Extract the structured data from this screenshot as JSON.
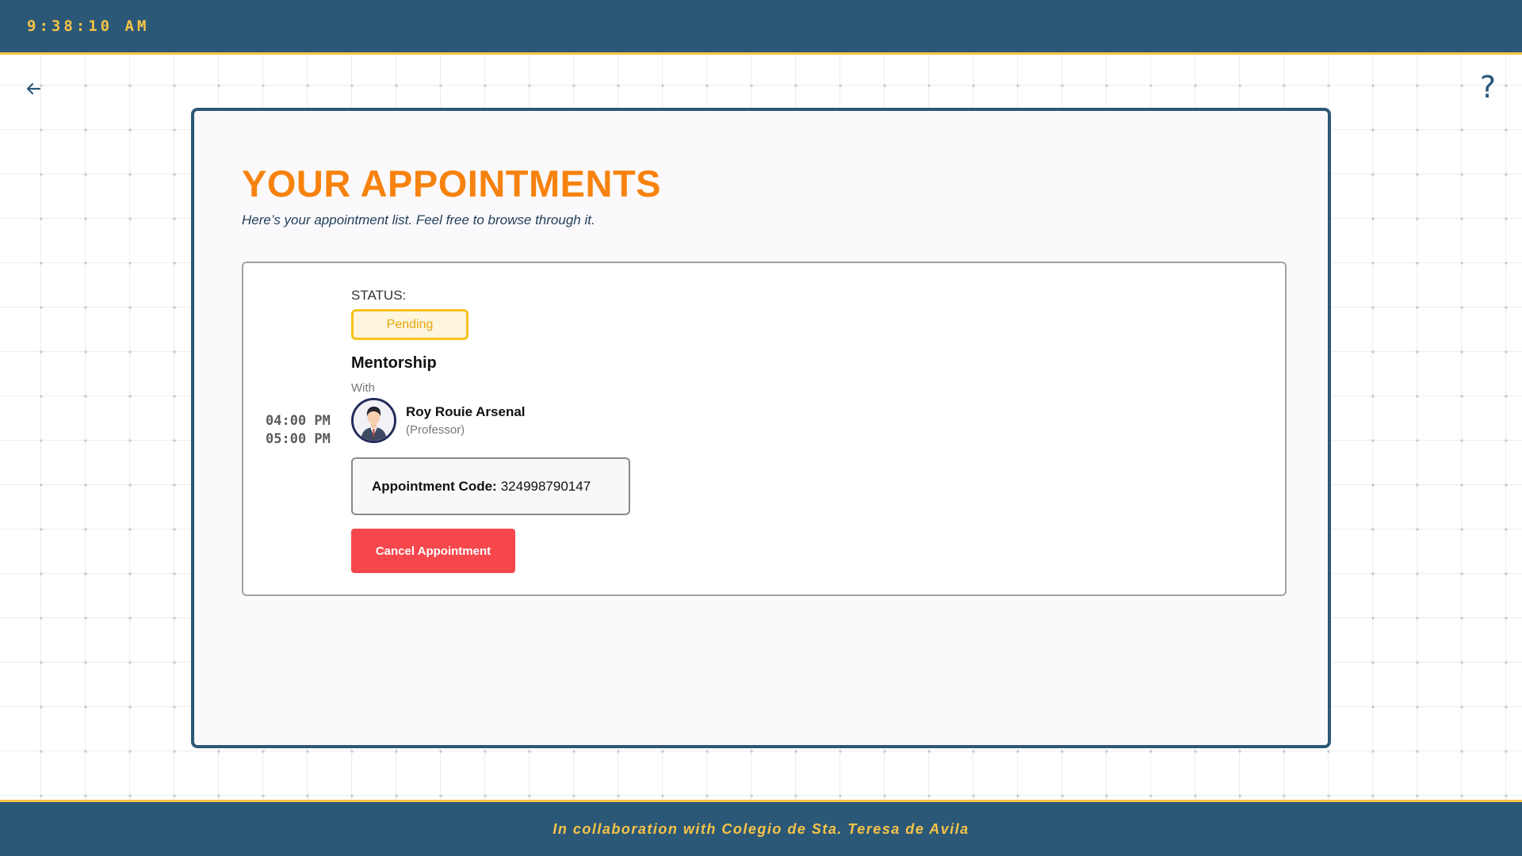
{
  "header": {
    "clock": "9:38:10 AM",
    "bg_color": "#2c5878",
    "accent_color": "#f6c445"
  },
  "nav": {
    "back_icon": "arrow-left-icon",
    "help_label": "?"
  },
  "main": {
    "title": "YOUR APPOINTMENTS",
    "title_color": "#f7820e",
    "subtitle": "Here’s your appointment list. Feel free to browse through it."
  },
  "appointments": [
    {
      "start_time": "04:00 PM",
      "end_time": "05:00 PM",
      "status_label": "STATUS:",
      "status": "Pending",
      "status_color": "#f8c21c",
      "type": "Mentorship",
      "with_label": "With",
      "avatar_icon": "professor-avatar-icon",
      "person_name": "Roy Rouie Arsenal",
      "person_role": "(Professor)",
      "code_label": "Appointment Code:",
      "code": "324998790147",
      "cancel_label": "Cancel Appointment",
      "cancel_color": "#f5474c"
    }
  ],
  "footer": {
    "text": "In collaboration with Colegio de Sta. Teresa de Avila"
  }
}
